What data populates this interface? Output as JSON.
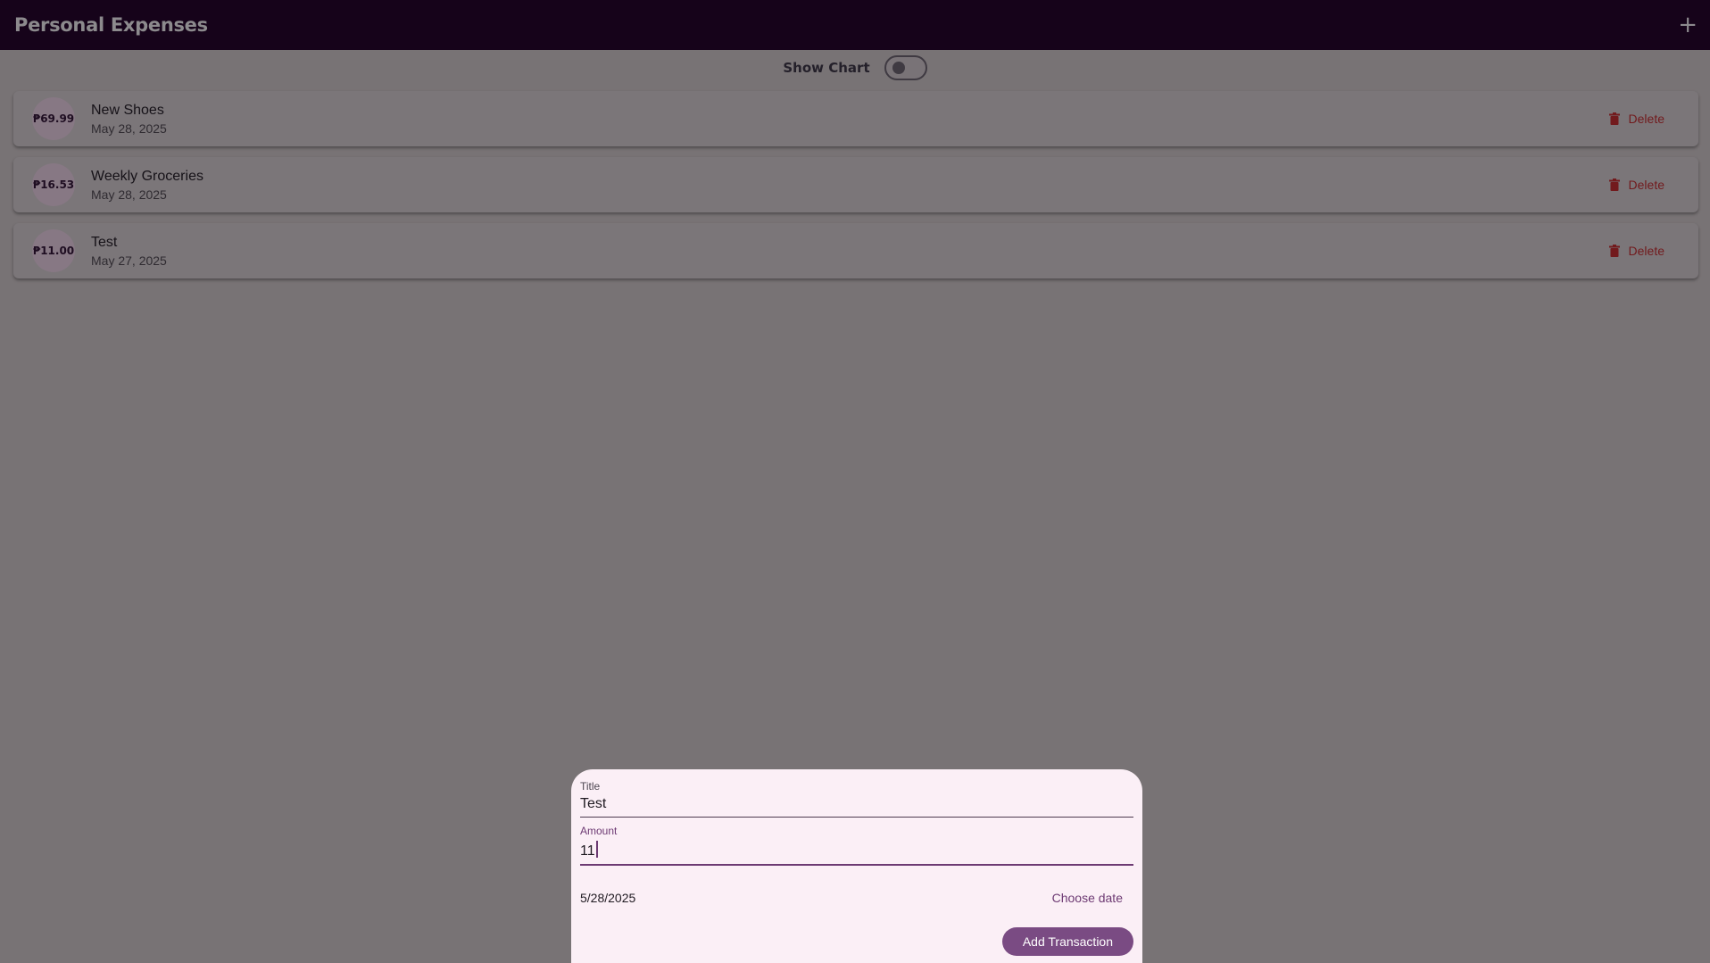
{
  "app_bar": {
    "title": "Personal Expenses",
    "add_icon": "plus-icon",
    "add_glyph": "+"
  },
  "chart_toggle": {
    "label": "Show Chart",
    "state": "off"
  },
  "transactions": [
    {
      "amount": "₱69.99",
      "title": "New Shoes",
      "date": "May 28, 2025",
      "delete_label": "Delete"
    },
    {
      "amount": "₱16.53",
      "title": "Weekly Groceries",
      "date": "May 28, 2025",
      "delete_label": "Delete"
    },
    {
      "amount": "₱11.00",
      "title": "Test",
      "date": "May 27, 2025",
      "delete_label": "Delete"
    }
  ],
  "new_transaction_form": {
    "title_label": "Title",
    "title_value": "Test",
    "amount_label": "Amount",
    "amount_value": "11",
    "date_value": "5/28/2025",
    "choose_date_label": "Choose date",
    "submit_label": "Add Transaction"
  },
  "colors": {
    "app_bar": "#16031a",
    "accent": "#7a4b83",
    "delete": "#721a1d",
    "sheet_background": "#fbeff6"
  }
}
